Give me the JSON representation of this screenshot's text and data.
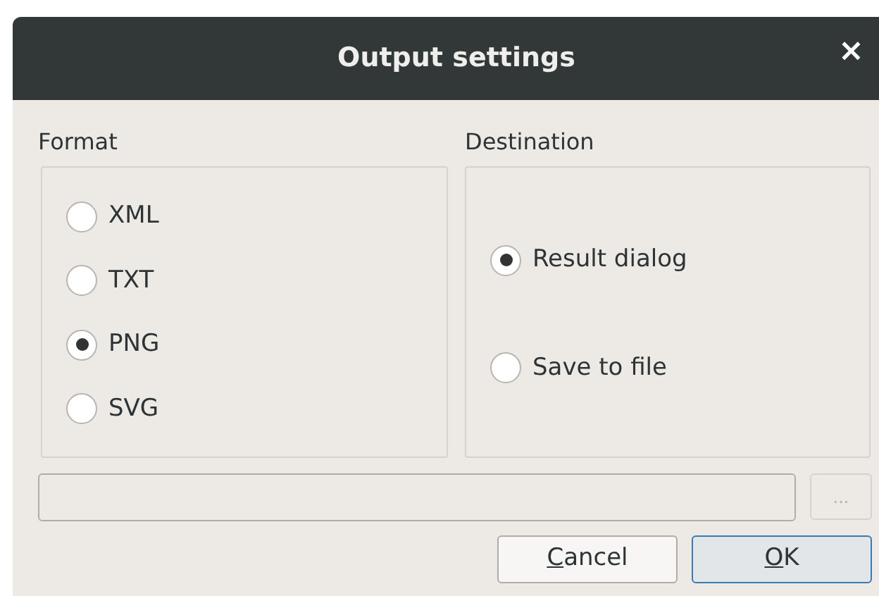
{
  "window": {
    "title": "Output settings",
    "close": "×"
  },
  "format": {
    "label": "Format",
    "options": [
      {
        "label": "XML",
        "selected": false
      },
      {
        "label": "TXT",
        "selected": false
      },
      {
        "label": "PNG",
        "selected": true
      },
      {
        "label": "SVG",
        "selected": false
      }
    ]
  },
  "destination": {
    "label": "Destination",
    "options": [
      {
        "label": "Result dialog",
        "selected": true
      },
      {
        "label": "Save to file",
        "selected": false
      }
    ]
  },
  "path_field": {
    "disabled": true
  },
  "browse_button": {
    "label": "...",
    "disabled": true
  },
  "buttons": [
    {
      "mnemonic": "C",
      "rest": "ancel",
      "default": false
    },
    {
      "mnemonic": "O",
      "rest": "K",
      "default": true
    }
  ]
}
